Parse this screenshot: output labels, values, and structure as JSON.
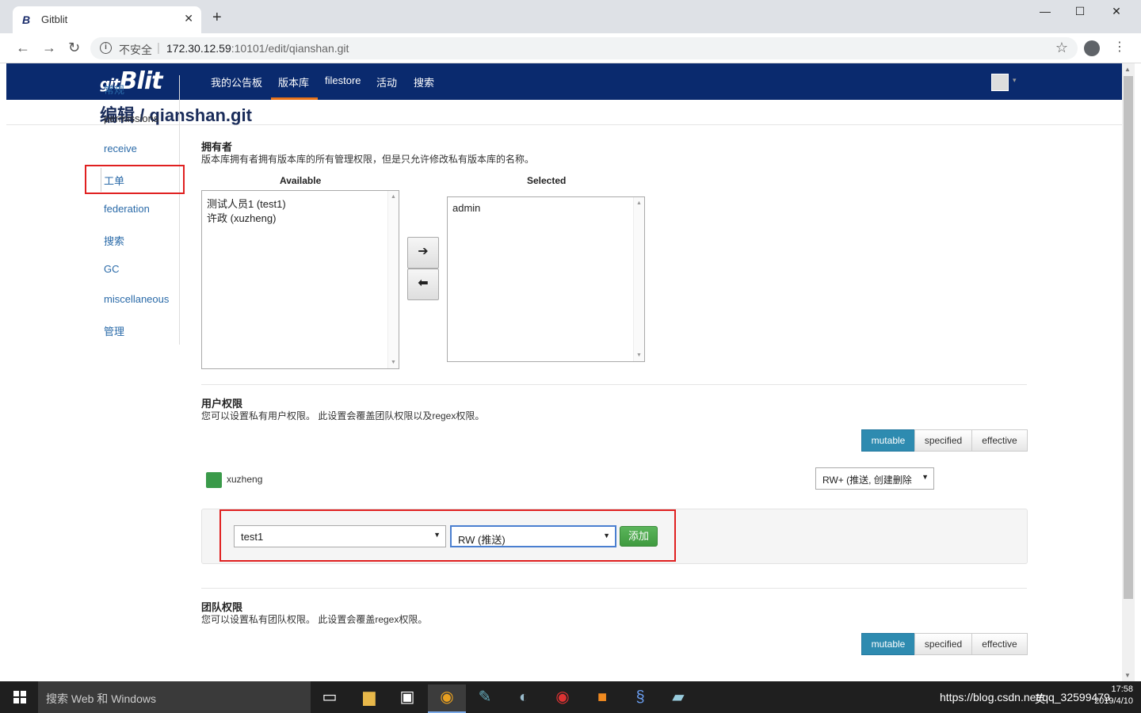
{
  "browser": {
    "tab_title": "Gitblit",
    "tab_favicon": "B",
    "close_glyph": "✕",
    "new_tab_glyph": "+",
    "minimize_glyph": "—",
    "maximize_glyph": "☐",
    "window_close_glyph": "✕",
    "back_glyph": "←",
    "forward_glyph": "→",
    "reload_glyph": "↻",
    "info_glyph": "i",
    "insecure_label": "不安全",
    "separator": "|",
    "url_host": "172.30.12.59",
    "url_path": ":10101/edit/qianshan.git",
    "star_glyph": "☆",
    "menu_glyph": "⋮"
  },
  "navbar": {
    "brand": "Blit",
    "brand_prefix": "git",
    "links": [
      "我的公告板",
      "版本库",
      "filestore",
      "活动",
      "搜索"
    ],
    "active_link": "版本库",
    "caret": "▾"
  },
  "page": {
    "title": "编辑 / qianshan.git"
  },
  "sidebar": {
    "items": [
      "常规",
      "permissions",
      "receive",
      "工单",
      "federation",
      "搜索",
      "GC",
      "miscellaneous",
      "管理"
    ],
    "active": "permissions"
  },
  "owners": {
    "title": "拥有者",
    "description": "版本库拥有者拥有版本库的所有管理权限，但是只允许修改私有版本库的名称。",
    "available_label": "Available",
    "selected_label": "Selected",
    "available": [
      "测试人员1 (test1)",
      "许政 (xuzheng)"
    ],
    "selected": [
      "admin"
    ],
    "move_right_glyph": "➔",
    "move_left_glyph": "⬅",
    "scroll_up": "▲",
    "scroll_down": "▼"
  },
  "user_permissions": {
    "title": "用户权限",
    "description": "您可以设置私有用户权限。 此设置会覆盖团队权限以及regex权限。",
    "view_modes": [
      "mutable",
      "specified",
      "effective"
    ],
    "active_mode": "mutable",
    "entries": [
      {
        "user": "xuzheng",
        "permission": "RW+ (推送, 创建删除"
      }
    ],
    "add_user_value": "test1",
    "add_permission_value": "RW (推送)",
    "add_button": "添加",
    "caret": "▼"
  },
  "team_permissions": {
    "title": "团队权限",
    "description": "您可以设置私有团队权限。 此设置会覆盖regex权限。",
    "view_modes": [
      "mutable",
      "specified",
      "effective"
    ],
    "active_mode": "mutable"
  },
  "taskbar": {
    "search_placeholder": "搜索 Web 和 Windows",
    "tray_text": "https://blog.csdn.net/qq_32599479",
    "ime": "英",
    "time": "17:58",
    "date": "2019/4/10"
  },
  "colors": {
    "navbar_bg": "#0a2a6e",
    "active_underline": "#e8731a",
    "link": "#2a6aa8",
    "active_toggle": "#2e8bb0",
    "add_button": "#4aa84a",
    "highlight_box": "#e02020"
  }
}
